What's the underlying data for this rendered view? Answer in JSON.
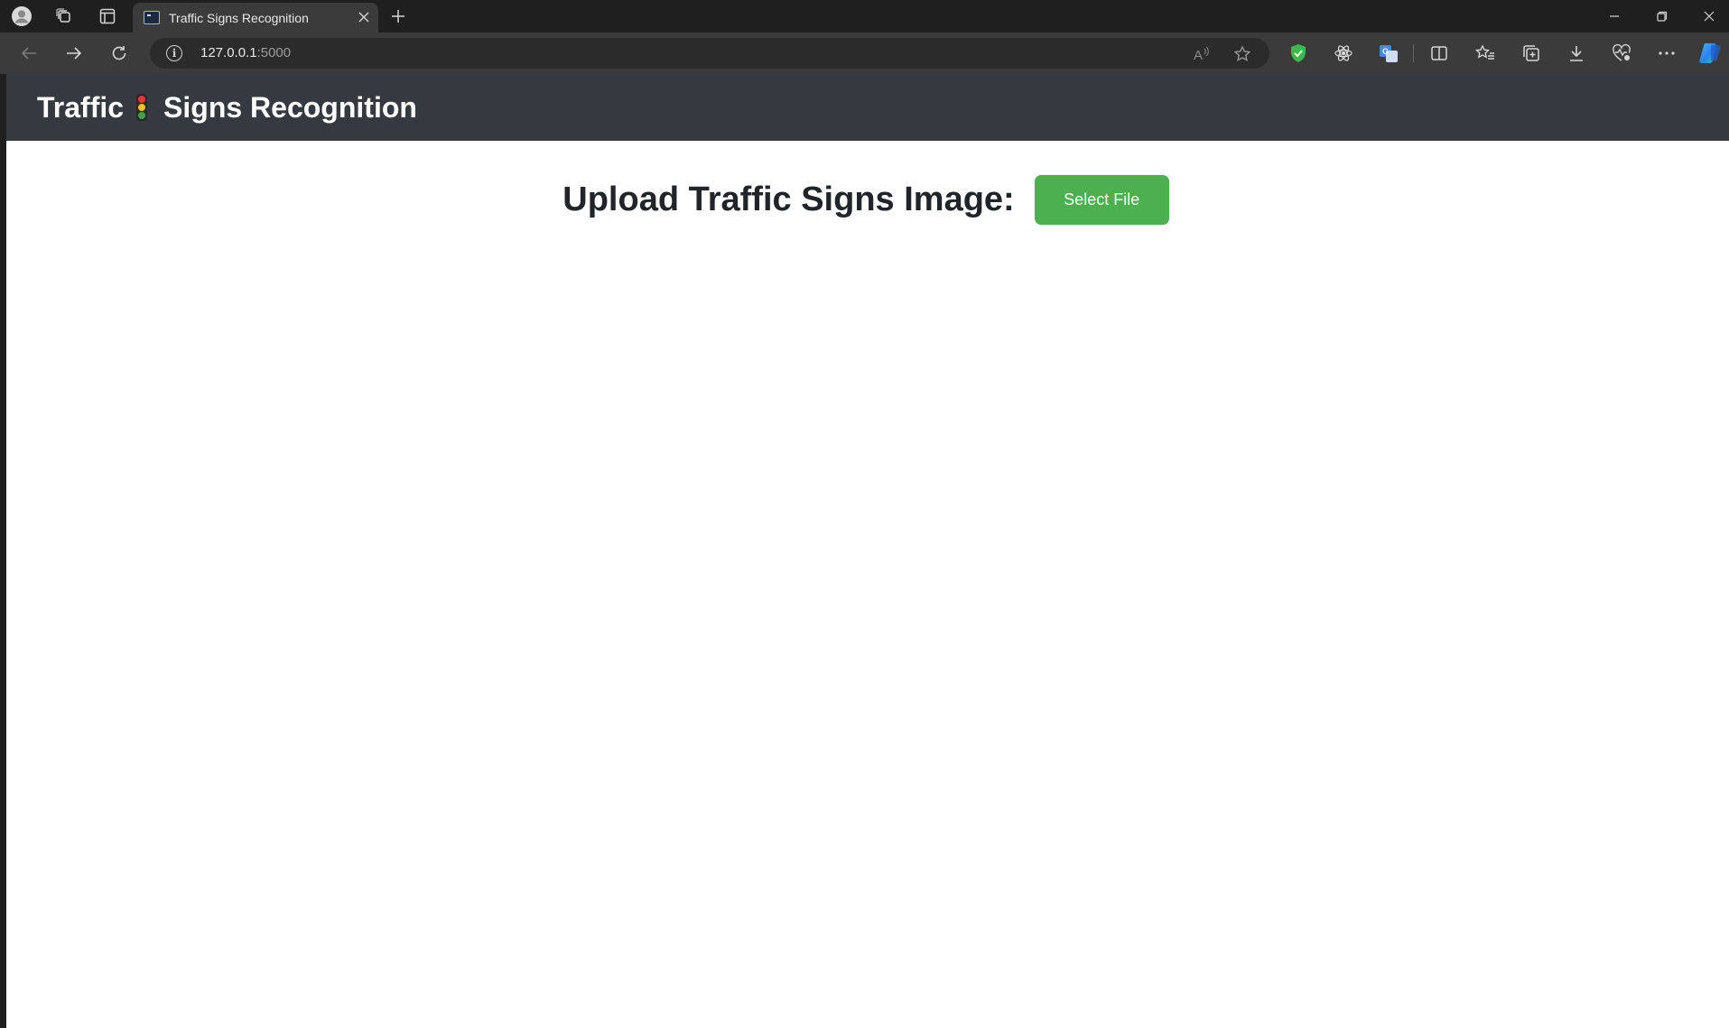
{
  "browser": {
    "tab_title": "Traffic Signs Recognition",
    "url_host": "127.0.0.1",
    "url_port": ":5000",
    "read_aloud_label": "A"
  },
  "app": {
    "brand_word1": "Traffic",
    "brand_word2": "Signs Recognition",
    "upload_label": "Upload Traffic Signs Image:",
    "select_button_label": "Select File",
    "colors": {
      "header_bg": "#343a40",
      "button_bg": "#4caf50",
      "button_text": "#ffffff"
    }
  },
  "icons": {
    "profile": "profile-avatar-icon",
    "workspaces": "workspaces-icon",
    "tab_actions": "tab-actions-icon",
    "new_tab": "plus-icon",
    "tab_close": "close-icon",
    "back": "back-arrow-icon",
    "forward": "forward-arrow-icon",
    "refresh": "refresh-icon",
    "site_info": "info-icon",
    "read_aloud": "read-aloud-icon",
    "favorite": "star-icon",
    "ext_shield": "shield-check-icon",
    "ext_react": "atom-icon",
    "ext_translate": "translate-icon",
    "split": "split-screen-icon",
    "favorites": "favorites-icon",
    "collections": "collections-icon",
    "downloads": "download-icon",
    "performance": "heart-pulse-icon",
    "more": "more-icon",
    "copilot": "copilot-icon"
  }
}
